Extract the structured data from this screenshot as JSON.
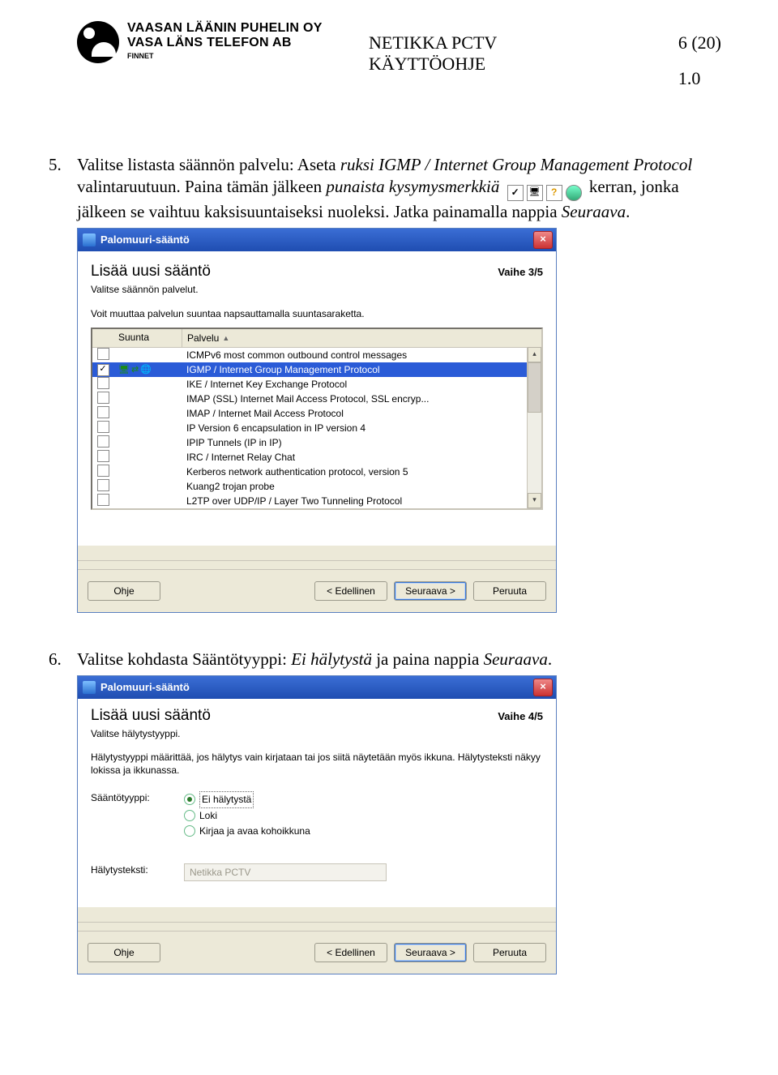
{
  "header": {
    "logo_line1": "VAASAN LÄÄNIN PUHELIN OY",
    "logo_line2": "VASA LÄNS TELEFON AB",
    "logo_finnet": "FINNET",
    "center_line1": "NETIKKA PCTV",
    "center_line2": "KÄYTTÖOHJE",
    "page": "6 (20)",
    "version": "1.0"
  },
  "step5": {
    "num": "5.",
    "pre": "Valitse listasta säännön palvelu: Aseta ",
    "ruksi": "ruksi IGMP / Internet Group Management Protocol",
    "mid1": " valintaruutuun. Paina tämän jälkeen ",
    "punaista": "punaista kysymysmerkkiä",
    "mid2": " kerran, jonka jälkeen se vaihtuu kaksisuuntaiseksi nuoleksi. Jatka painamalla nappia ",
    "seuraava": "Seuraava",
    "end": "."
  },
  "dialog1": {
    "title": "Palomuuri-sääntö",
    "heading": "Lisää uusi sääntö",
    "step": "Vaihe 3/5",
    "sub": "Valitse säännön palvelut.",
    "note": "Voit muuttaa palvelun suuntaa napsauttamalla suuntasaraketta.",
    "col_dir": "Suunta",
    "col_svc": "Palvelu",
    "rows": [
      {
        "checked": false,
        "selected": false,
        "label": "ICMPv6 most common outbound control messages"
      },
      {
        "checked": true,
        "selected": true,
        "label": "IGMP / Internet Group Management Protocol"
      },
      {
        "checked": false,
        "selected": false,
        "label": "IKE / Internet Key Exchange Protocol"
      },
      {
        "checked": false,
        "selected": false,
        "label": "IMAP (SSL) Internet Mail Access Protocol, SSL encryp..."
      },
      {
        "checked": false,
        "selected": false,
        "label": "IMAP / Internet Mail Access Protocol"
      },
      {
        "checked": false,
        "selected": false,
        "label": "IP Version 6 encapsulation in IP version 4"
      },
      {
        "checked": false,
        "selected": false,
        "label": "IPIP Tunnels (IP in IP)"
      },
      {
        "checked": false,
        "selected": false,
        "label": "IRC / Internet Relay Chat"
      },
      {
        "checked": false,
        "selected": false,
        "label": "Kerberos network authentication protocol, version 5"
      },
      {
        "checked": false,
        "selected": false,
        "label": "Kuang2 trojan probe"
      },
      {
        "checked": false,
        "selected": false,
        "label": "L2TP over UDP/IP / Layer Two Tunneling Protocol"
      }
    ],
    "btn_help": "Ohje",
    "btn_prev": "< Edellinen",
    "btn_next": "Seuraava >",
    "btn_cancel": "Peruuta"
  },
  "step6": {
    "num": "6.",
    "pre": "Valitse kohdasta Sääntötyyppi: ",
    "ei": "Ei hälytystä",
    "mid": " ja paina nappia ",
    "seuraava": "Seuraava",
    "end": "."
  },
  "dialog2": {
    "title": "Palomuuri-sääntö",
    "heading": "Lisää uusi sääntö",
    "step": "Vaihe 4/5",
    "sub": "Valitse hälytystyyppi.",
    "copy": "Hälytystyyppi määrittää, jos hälytys vain kirjataan tai jos siitä näytetään myös ikkuna. Hälytysteksti näkyy lokissa ja ikkunassa.",
    "label_type": "Sääntötyyppi:",
    "opts": [
      "Ei hälytystä",
      "Loki",
      "Kirjaa ja avaa kohoikkuna"
    ],
    "label_text": "Hälytysteksti:",
    "text_value": "Netikka PCTV",
    "btn_help": "Ohje",
    "btn_prev": "< Edellinen",
    "btn_next": "Seuraava >",
    "btn_cancel": "Peruuta"
  }
}
